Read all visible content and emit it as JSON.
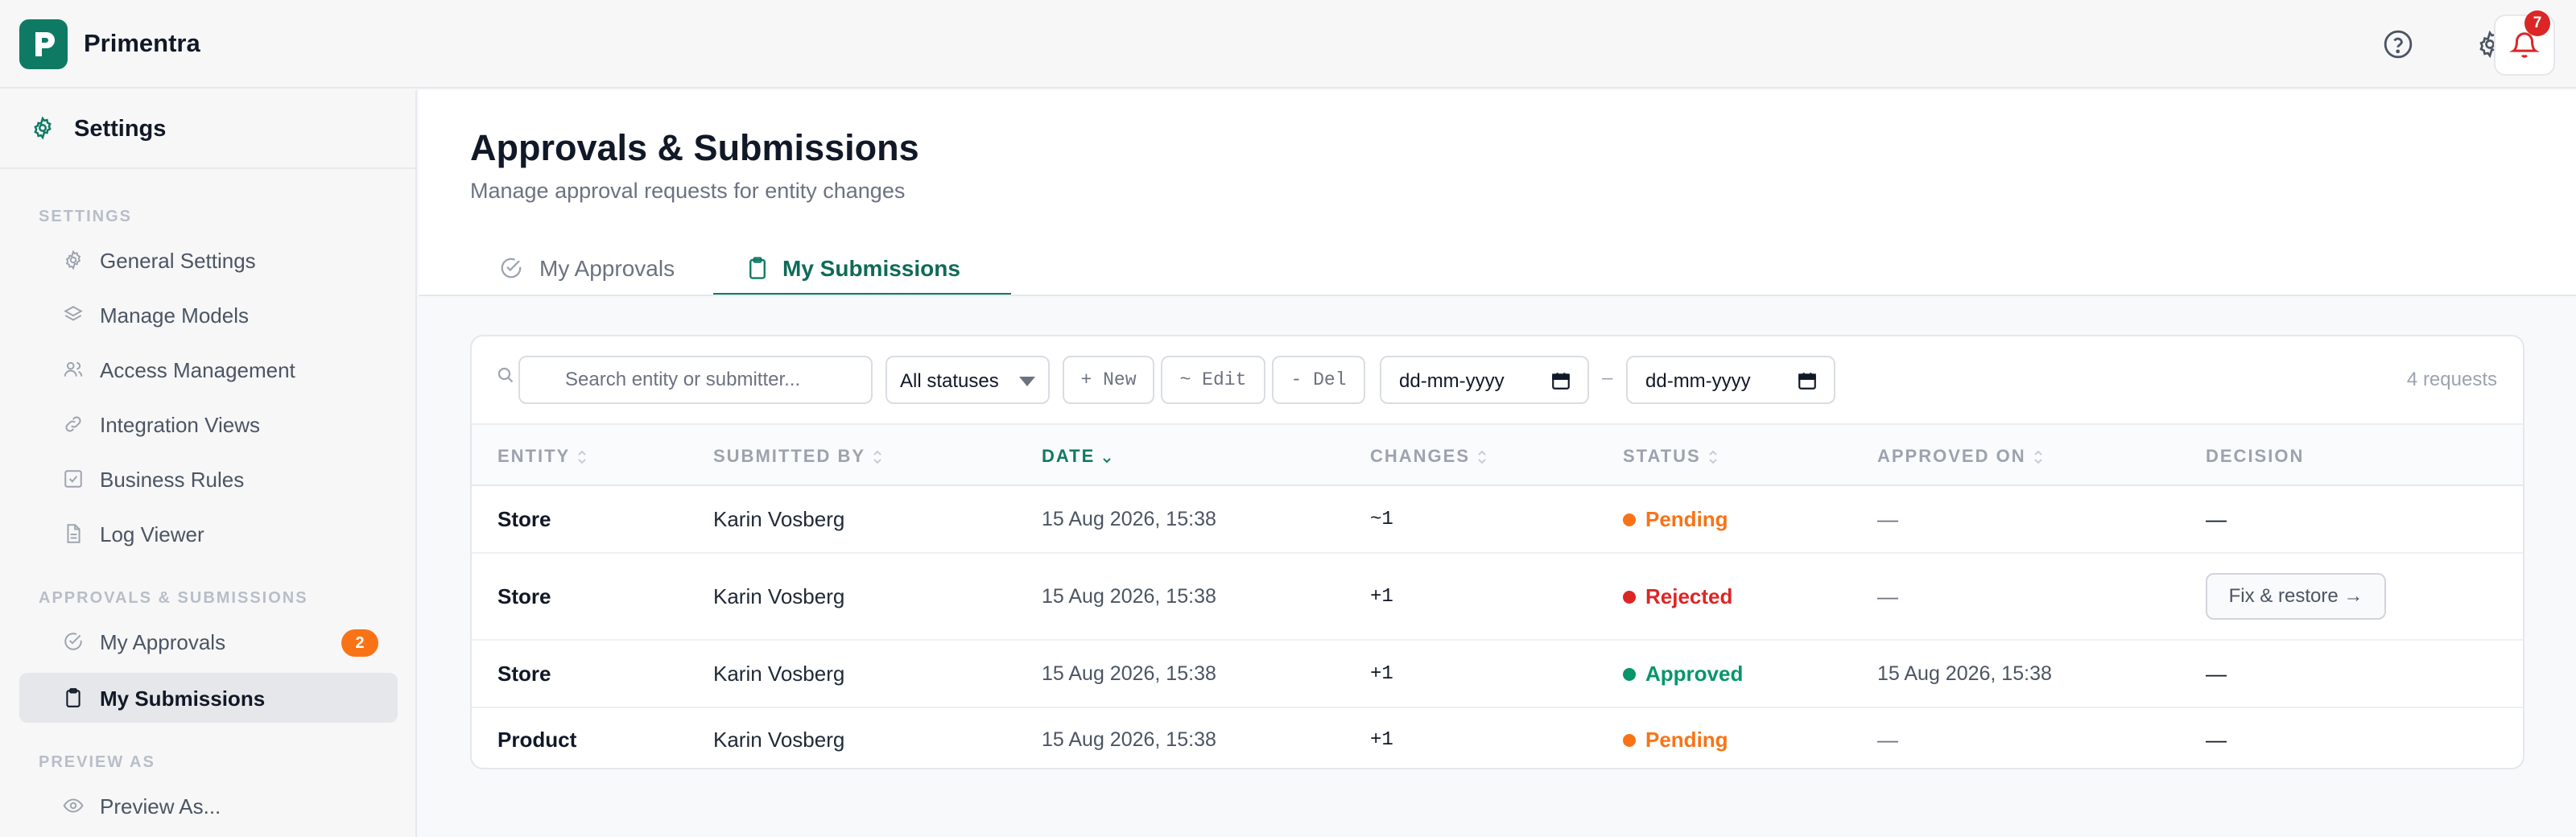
{
  "app": {
    "brand": "Primentra",
    "notifications_count": "7"
  },
  "sidebar": {
    "header": "Settings",
    "sections": {
      "settings": "SETTINGS",
      "approvals": "APPROVALS & SUBMISSIONS",
      "preview": "PREVIEW AS"
    },
    "items": [
      {
        "label": "General Settings",
        "icon": "gear-icon"
      },
      {
        "label": "Manage Models",
        "icon": "layers-icon"
      },
      {
        "label": "Access Management",
        "icon": "users-icon"
      },
      {
        "label": "Integration Views",
        "icon": "link-icon"
      },
      {
        "label": "Business Rules",
        "icon": "check-square-icon"
      },
      {
        "label": "Log Viewer",
        "icon": "file-icon"
      },
      {
        "label": "My Approvals",
        "icon": "check-circle-icon",
        "badge": "2"
      },
      {
        "label": "My Submissions",
        "icon": "clipboard-icon",
        "active": true
      },
      {
        "label": "Preview As...",
        "icon": "eye-icon"
      }
    ]
  },
  "main": {
    "title": "Approvals & Submissions",
    "subtitle": "Manage approval requests for entity changes",
    "tabs": [
      {
        "label": "My Approvals",
        "icon": "check-circle-icon"
      },
      {
        "label": "My Submissions",
        "icon": "clipboard-icon",
        "active": true
      }
    ],
    "toolbar": {
      "search_placeholder": "Search entity or submitter...",
      "status_filter": "All statuses",
      "new_label": "+ New",
      "edit_label": "~ Edit",
      "del_label": "- Del",
      "date_from": "dd-mm-yyyy",
      "date_to": "dd-mm-yyyy",
      "date_separator": "–",
      "count": "4 requests"
    },
    "table": {
      "columns": [
        "ENTITY",
        "SUBMITTED BY",
        "DATE",
        "CHANGES",
        "STATUS",
        "APPROVED ON",
        "DECISION"
      ],
      "rows": [
        {
          "entity": "Store",
          "submitted_by": "Karin Vosberg",
          "date": "15 Aug 2026, 15:38",
          "changes": "~1",
          "status": "Pending",
          "approved_on": "—",
          "decision": "—"
        },
        {
          "entity": "Store",
          "submitted_by": "Karin Vosberg",
          "date": "15 Aug 2026, 15:38",
          "changes": "+1",
          "status": "Rejected",
          "approved_on": "—",
          "decision": "Fix & restore →"
        },
        {
          "entity": "Store",
          "submitted_by": "Karin Vosberg",
          "date": "15 Aug 2026, 15:38",
          "changes": "+1",
          "status": "Approved",
          "approved_on": "15 Aug 2026, 15:38",
          "decision": "—"
        },
        {
          "entity": "Product",
          "submitted_by": "Karin Vosberg",
          "date": "15 Aug 2026, 15:38",
          "changes": "+1",
          "status": "Pending",
          "approved_on": "—",
          "decision": "—"
        }
      ]
    }
  },
  "colors": {
    "brand": "#0f7a63",
    "pending": "#f97316",
    "rejected": "#dc2626",
    "approved": "#059669",
    "badge": "#f97316",
    "notification": "#dc2626"
  }
}
